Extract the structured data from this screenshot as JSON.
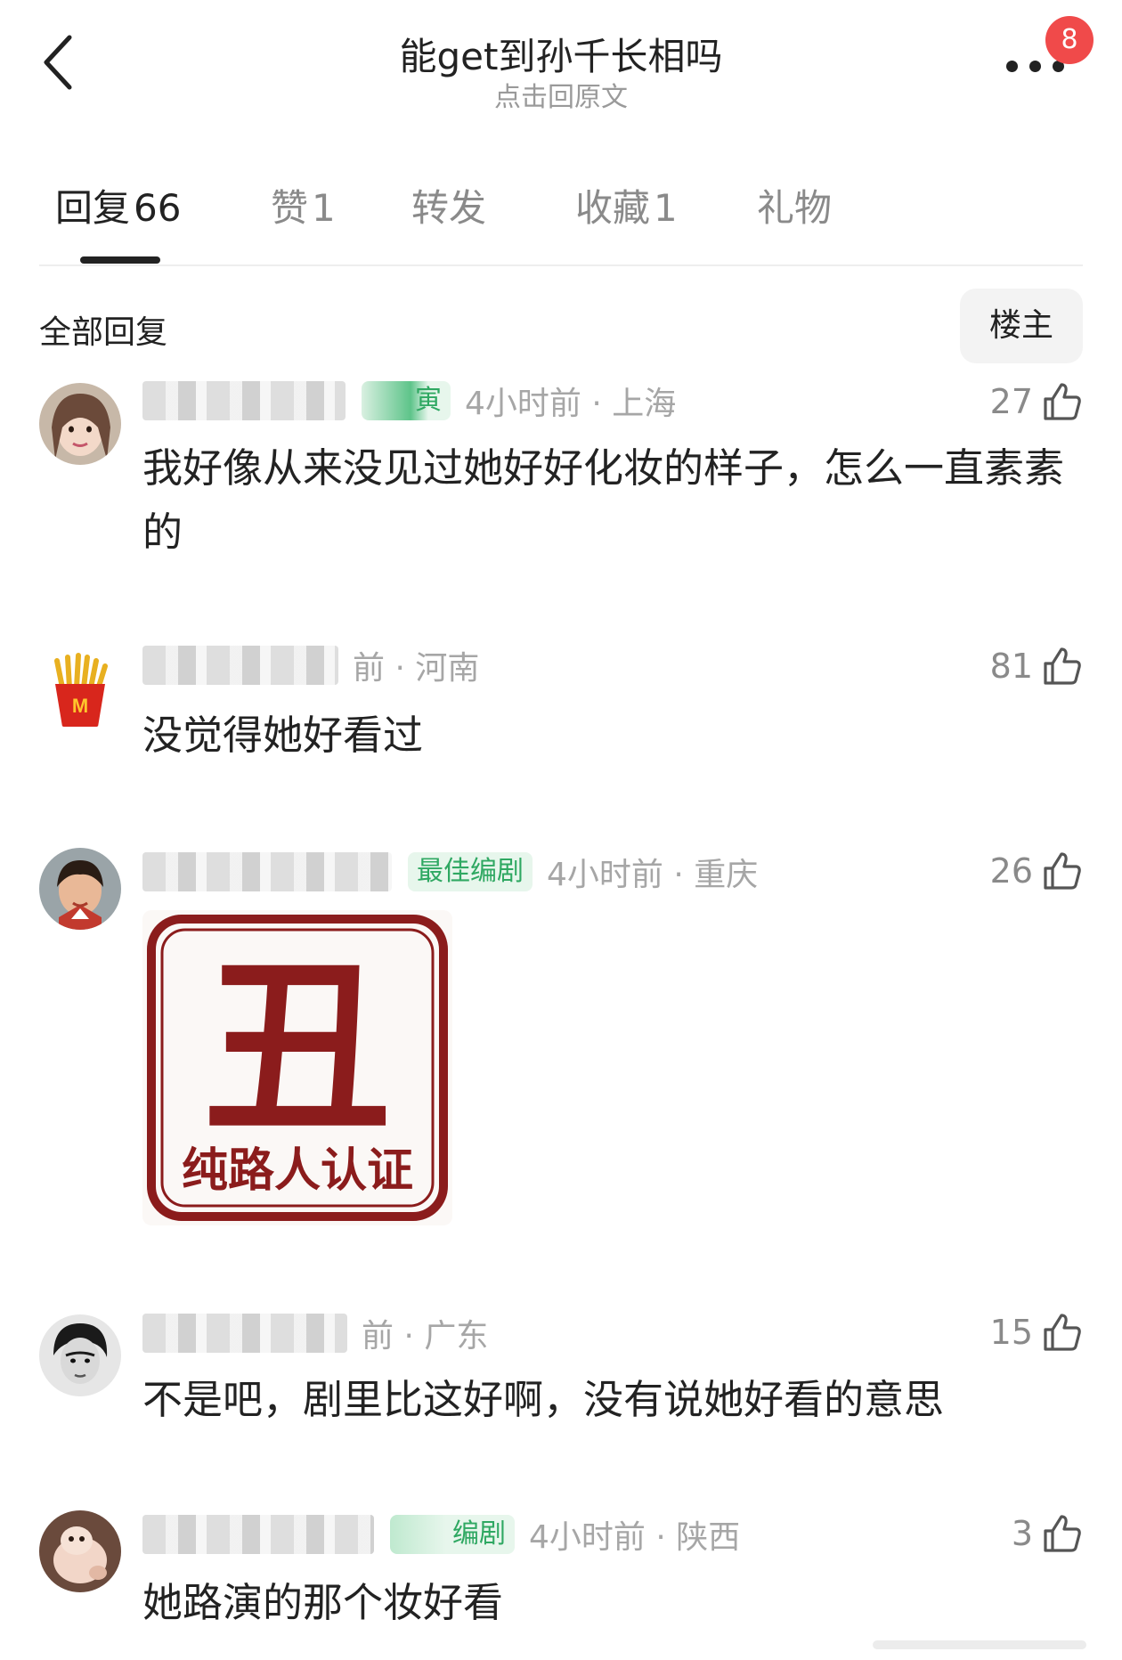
{
  "header": {
    "title": "能get到孙千长相吗",
    "subtitle": "点击回原文",
    "notification_count": "8"
  },
  "tabs": [
    {
      "label": "回复",
      "count": "66"
    },
    {
      "label": "赞",
      "count": "1"
    },
    {
      "label": "转发",
      "count": ""
    },
    {
      "label": "收藏",
      "count": "1"
    },
    {
      "label": "礼物",
      "count": ""
    }
  ],
  "section": {
    "title": "全部回复",
    "op_filter_label": "楼主"
  },
  "comments": [
    {
      "badge": "寅",
      "time_loc": "4小时前 · 上海",
      "likes": "27",
      "text": "我好像从来没见过她好好化妆的样子，怎么一直素素的"
    },
    {
      "badge": "",
      "time_loc": "前 · 河南",
      "likes": "81",
      "text": "没觉得她好看过"
    },
    {
      "badge": "最佳编剧",
      "time_loc": "4小时前 · 重庆",
      "likes": "26",
      "text": "",
      "image": {
        "big_char": "丑",
        "caption": "纯路人认证"
      }
    },
    {
      "badge": "",
      "time_loc": "前 · 广东",
      "likes": "15",
      "text": "不是吧，剧里比这好啊，没有说她好看的意思"
    },
    {
      "badge": "编剧",
      "time_loc": "4小时前 · 陕西",
      "likes": "3",
      "text": "她路演的那个妆好看"
    }
  ],
  "icons": {
    "back": "chevron-left-icon",
    "more": "more-dots-icon",
    "like": "thumbs-up-icon"
  },
  "colors": {
    "badge_bg": "#e7f6ec",
    "badge_text": "#2fa862",
    "notification": "#f04a4a",
    "stamp_red": "#8b1c1c"
  }
}
